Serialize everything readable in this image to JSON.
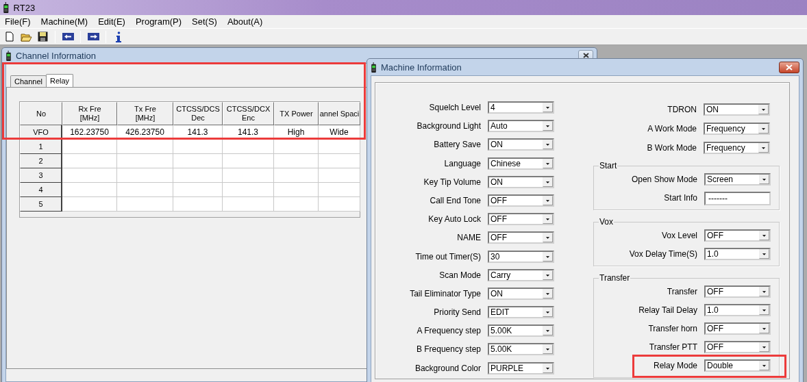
{
  "app": {
    "title": "RT23"
  },
  "menu": [
    "File(F)",
    "Machine(M)",
    "Edit(E)",
    "Program(P)",
    "Set(S)",
    "About(A)"
  ],
  "channel_window": {
    "title": "Channel Information",
    "highlighted": true,
    "tabs": [
      {
        "label": "Channel",
        "selected": false
      },
      {
        "label": "Relay",
        "selected": true
      }
    ],
    "table": {
      "columns": [
        "No",
        "Rx Fre\n[MHz]",
        "Tx Fre\n[MHz]",
        "CTCSS/DCS\nDec",
        "CTCSS/DCX\nEnc",
        "TX Power",
        "annel Spaci"
      ],
      "rows": [
        {
          "no": "VFO",
          "cells": [
            "162.23750",
            "426.23750",
            "141.3",
            "141.3",
            "High",
            "Wide"
          ]
        },
        {
          "no": "1"
        },
        {
          "no": "2"
        },
        {
          "no": "3"
        },
        {
          "no": "4"
        },
        {
          "no": "5"
        }
      ]
    }
  },
  "machine_window": {
    "title": "Machine Information",
    "left_fields": [
      {
        "label": "Squelch Level",
        "value": "4"
      },
      {
        "label": "Background Light",
        "value": "Auto"
      },
      {
        "label": "Battery Save",
        "value": "ON"
      },
      {
        "label": "Language",
        "value": "Chinese"
      },
      {
        "label": "Key Tip Volume",
        "value": "ON"
      },
      {
        "label": "Call End Tone",
        "value": "OFF"
      },
      {
        "label": "Key Auto Lock",
        "value": "OFF"
      },
      {
        "label": "NAME",
        "value": "OFF"
      },
      {
        "label": "Time out Timer(S)",
        "value": "30"
      },
      {
        "label": "Scan Mode",
        "value": "Carry"
      },
      {
        "label": "Tail Eliminator Type",
        "value": "ON"
      },
      {
        "label": "Priority Send",
        "value": "EDIT"
      },
      {
        "label": "A Frequency step",
        "value": "5.00K"
      },
      {
        "label": "B Frequency step",
        "value": "5.00K"
      },
      {
        "label": "Background Color",
        "value": "PURPLE"
      }
    ],
    "right_fields": [
      {
        "label": "TDRON",
        "value": "ON"
      },
      {
        "label": "A Work Mode",
        "value": "Frequency"
      },
      {
        "label": "B Work Mode",
        "value": "Frequency"
      }
    ],
    "groups": [
      {
        "title": "Start",
        "fields": [
          {
            "label": "Open Show Mode",
            "value": "Screen",
            "kind": "dropdown"
          },
          {
            "label": "Start Info",
            "value": "-------",
            "kind": "text"
          }
        ]
      },
      {
        "title": "Vox",
        "fields": [
          {
            "label": "Vox Level",
            "value": "OFF",
            "kind": "dropdown"
          },
          {
            "label": "Vox Delay Time(S)",
            "value": "1.0",
            "kind": "dropdown"
          }
        ]
      },
      {
        "title": "Transfer",
        "fields": [
          {
            "label": "Transfer",
            "value": "OFF",
            "kind": "dropdown"
          },
          {
            "label": "Relay Tail Delay",
            "value": "1.0",
            "kind": "dropdown"
          },
          {
            "label": "Transfer horn",
            "value": "OFF",
            "kind": "dropdown"
          },
          {
            "label": "Transfer PTT",
            "value": "OFF",
            "kind": "dropdown"
          },
          {
            "label": "Relay Mode",
            "value": "Double",
            "kind": "dropdown",
            "highlighted": true
          }
        ]
      }
    ]
  }
}
